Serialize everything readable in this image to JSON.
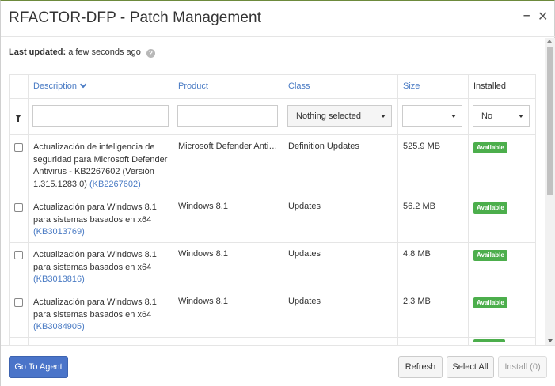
{
  "window": {
    "title": "RFACTOR-DFP - Patch Management",
    "minimize_glyph": "–",
    "close_glyph": "✕"
  },
  "status": {
    "last_updated_label": "Last updated:",
    "last_updated_value": "a few seconds ago",
    "help_glyph": "?"
  },
  "table": {
    "columns": {
      "description": "Description",
      "product": "Product",
      "class": "Class",
      "size": "Size",
      "installed": "Installed"
    },
    "filters": {
      "description_value": "",
      "product_value": "",
      "class_selected": "Nothing selected",
      "size_selected": "",
      "installed_selected": "No"
    },
    "rows": [
      {
        "description": "Actualización de inteligencia de seguridad para Microsoft Defender Antivirus - KB2267602 (Versión 1.315.1283.0)",
        "kb": "(KB2267602)",
        "product": "Microsoft Defender Antivirus",
        "class": "Definition Updates",
        "size": "525.9 MB",
        "status": "Available"
      },
      {
        "description": "Actualización para Windows 8.1 para sistemas basados en x64",
        "kb": "(KB3013769)",
        "product": "Windows 8.1",
        "class": "Updates",
        "size": "56.2 MB",
        "status": "Available"
      },
      {
        "description": "Actualización para Windows 8.1 para sistemas basados en x64",
        "kb": "(KB3013816)",
        "product": "Windows 8.1",
        "class": "Updates",
        "size": "4.8 MB",
        "status": "Available"
      },
      {
        "description": "Actualización para Windows 8.1 para sistemas basados en x64",
        "kb": "(KB3084905)",
        "product": "Windows 8.1",
        "class": "Updates",
        "size": "2.3 MB",
        "status": "Available"
      }
    ]
  },
  "footer": {
    "go_to_agent": "Go To Agent",
    "refresh": "Refresh",
    "select_all": "Select All",
    "install": "Install (0)"
  },
  "colors": {
    "accent": "#4a74c9",
    "link": "#4a7bc4",
    "badge_green": "#4cae4c"
  }
}
